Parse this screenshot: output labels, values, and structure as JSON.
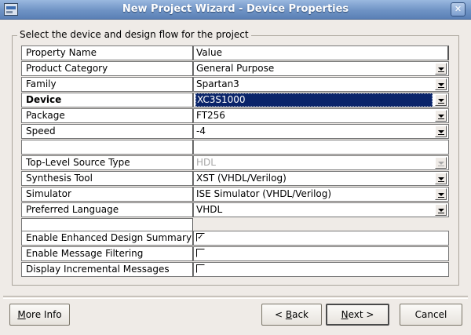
{
  "window": {
    "title": "New Project Wizard - Device Properties"
  },
  "group": {
    "label": "Select the device and design flow for the project"
  },
  "table": {
    "headers": {
      "name": "Property Name",
      "value": "Value"
    },
    "rows": [
      {
        "name": "Product Category",
        "value": "General Purpose"
      },
      {
        "name": "Family",
        "value": "Spartan3"
      },
      {
        "name": "Device",
        "value": "XC3S1000"
      },
      {
        "name": "Package",
        "value": "FT256"
      },
      {
        "name": "Speed",
        "value": "-4"
      },
      {
        "name": "Top-Level Source Type",
        "value": "HDL"
      },
      {
        "name": "Synthesis Tool",
        "value": "XST (VHDL/Verilog)"
      },
      {
        "name": "Simulator",
        "value": "ISE Simulator (VHDL/Verilog)"
      },
      {
        "name": "Preferred Language",
        "value": "VHDL"
      },
      {
        "name": "Enable Enhanced Design Summary",
        "checked": true
      },
      {
        "name": "Enable Message Filtering",
        "checked": false
      },
      {
        "name": "Display Incremental Messages",
        "checked": false
      }
    ]
  },
  "buttons": {
    "more_info": {
      "mnemonic": "M",
      "rest": "ore Info"
    },
    "back": {
      "pre": "< ",
      "mnemonic": "B",
      "rest": "ack"
    },
    "next": {
      "mnemonic": "N",
      "rest": "ext >"
    },
    "cancel": "Cancel"
  },
  "colors": {
    "selection": "#0a246a",
    "titlebar": "#6f93c4"
  }
}
